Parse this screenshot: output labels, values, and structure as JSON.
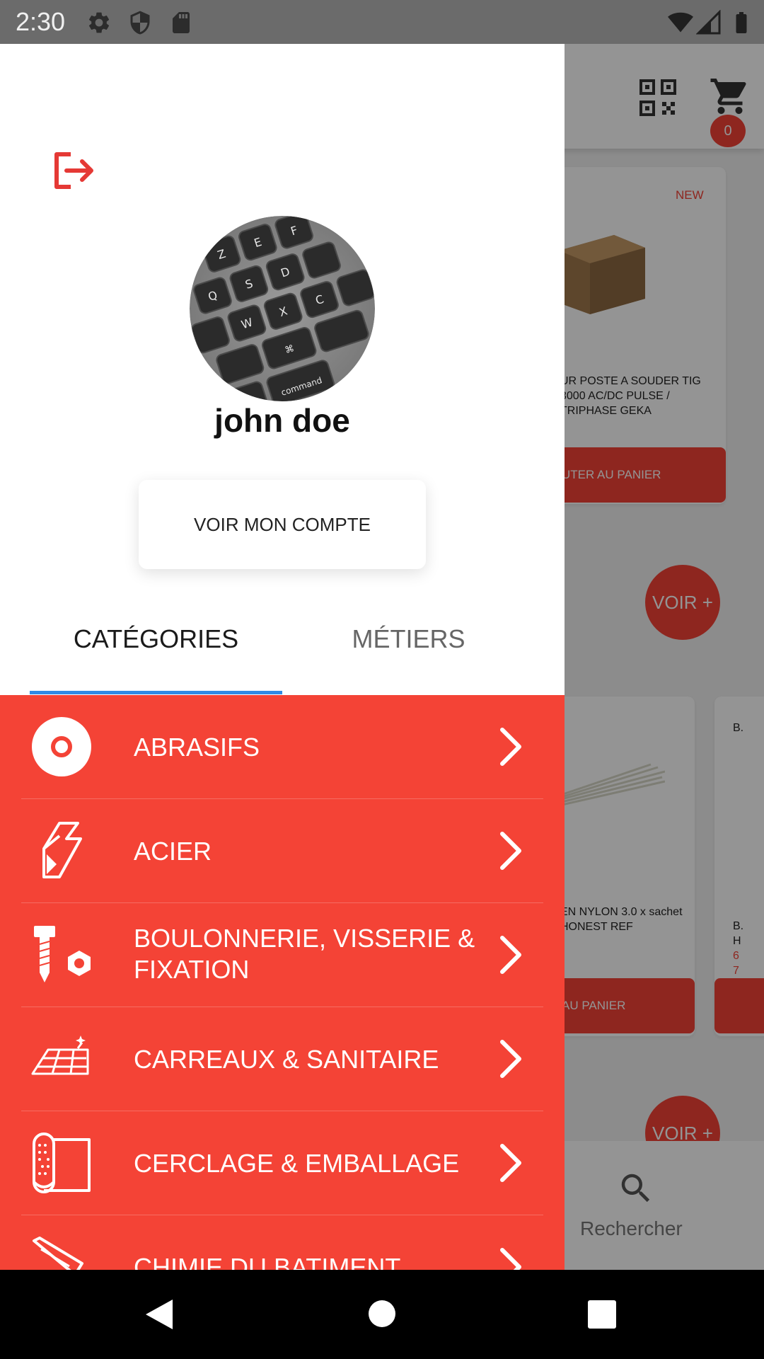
{
  "status_bar": {
    "time": "2:30"
  },
  "background": {
    "cart_count": "0",
    "products": [
      {
        "badge": "NEW",
        "name": "UR POSTE A SOUDER TIG 3000 AC/DC PULSE / TRIPHASE GEKA",
        "button": "UTER AU PANIER"
      },
      {
        "name": "EN NYLON 3.0 x sachet HONEST REF",
        "button": "AU PANIER"
      },
      {
        "name_top": "B.",
        "name_bottom": "B. H",
        "price_line1": "6",
        "price_line2": "7",
        "button": ""
      }
    ],
    "voir_label": "VOIR +",
    "search_label": "Rechercher"
  },
  "drawer": {
    "user_name": "john doe",
    "account_button": "VOIR MON COMPTE",
    "tabs": [
      {
        "label": "CATÉGORIES",
        "active": true
      },
      {
        "label": "MÉTIERS",
        "active": false
      }
    ],
    "categories": [
      {
        "label": "ABRASIFS",
        "icon": "abrasive-disc-icon"
      },
      {
        "label": "ACIER",
        "icon": "steel-profile-icon"
      },
      {
        "label": "BOULONNERIE, VISSERIE & FIXATION",
        "icon": "bolt-nut-icon"
      },
      {
        "label": "CARREAUX & SANITAIRE",
        "icon": "tiles-icon"
      },
      {
        "label": "CERCLAGE & EMBALLAGE",
        "icon": "packaging-roll-icon"
      },
      {
        "label": "CHIMIE DU BATIMENT",
        "icon": "caulk-gun-icon"
      }
    ]
  },
  "colors": {
    "accent": "#f44336",
    "tab_indicator": "#2f8ae5"
  }
}
